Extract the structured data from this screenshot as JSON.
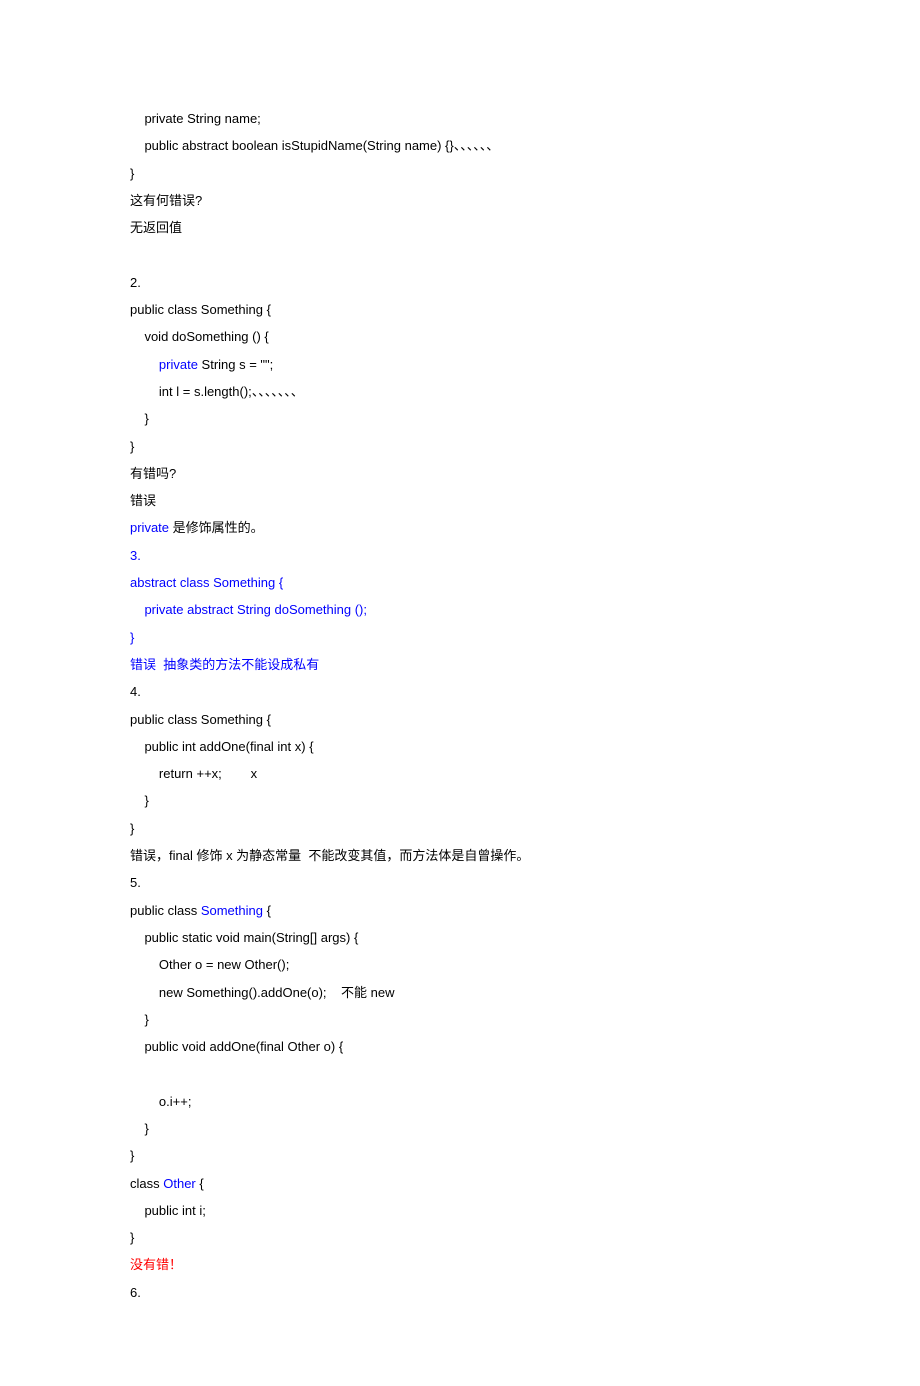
{
  "lines": [
    {
      "indent": 1,
      "segments": [
        {
          "text": "private String name;"
        }
      ]
    },
    {
      "indent": 1,
      "segments": [
        {
          "text": "public abstract boolean isStupidName(String name) {}、、、、、、"
        }
      ]
    },
    {
      "indent": 0,
      "segments": [
        {
          "text": "}"
        }
      ]
    },
    {
      "indent": 0,
      "segments": [
        {
          "text": "这有何错误?"
        }
      ]
    },
    {
      "indent": 0,
      "segments": [
        {
          "text": "无返回值"
        }
      ]
    },
    {
      "indent": 0,
      "segments": [
        {
          "text": " "
        }
      ]
    },
    {
      "indent": 0,
      "segments": [
        {
          "text": "2."
        }
      ]
    },
    {
      "indent": 0,
      "segments": [
        {
          "text": "public class Something {"
        }
      ]
    },
    {
      "indent": 1,
      "segments": [
        {
          "text": "void doSomething () {"
        }
      ]
    },
    {
      "indent": 2,
      "segments": [
        {
          "text": "private",
          "class": "blue"
        },
        {
          "text": " String s = \"\";"
        }
      ]
    },
    {
      "indent": 2,
      "segments": [
        {
          "text": "int l = s.length();、、、、、、、"
        }
      ]
    },
    {
      "indent": 1,
      "segments": [
        {
          "text": "}"
        }
      ]
    },
    {
      "indent": 0,
      "segments": [
        {
          "text": "}"
        }
      ]
    },
    {
      "indent": 0,
      "segments": [
        {
          "text": "有错吗?"
        }
      ]
    },
    {
      "indent": 0,
      "segments": [
        {
          "text": "错误"
        }
      ]
    },
    {
      "indent": 0,
      "segments": [
        {
          "text": "private ",
          "class": "blue"
        },
        {
          "text": "是修饰属性的。"
        }
      ]
    },
    {
      "indent": 0,
      "segments": [
        {
          "text": "3.",
          "class": "blue"
        }
      ]
    },
    {
      "indent": 0,
      "segments": [
        {
          "text": "abstract class Something {",
          "class": "blue"
        }
      ]
    },
    {
      "indent": 1,
      "segments": [
        {
          "text": "private abstract String doSomething ();",
          "class": "blue"
        }
      ]
    },
    {
      "indent": 0,
      "segments": [
        {
          "text": "}",
          "class": "blue"
        }
      ]
    },
    {
      "indent": 0,
      "segments": [
        {
          "text": "错误  抽象类的方法不能设成私有",
          "class": "blue"
        }
      ]
    },
    {
      "indent": 0,
      "segments": [
        {
          "text": "4."
        }
      ]
    },
    {
      "indent": 0,
      "segments": [
        {
          "text": "public class Something {"
        }
      ]
    },
    {
      "indent": 1,
      "segments": [
        {
          "text": "public int addOne(final int x) {"
        }
      ]
    },
    {
      "indent": 2,
      "segments": [
        {
          "text": "return ++x;        x"
        }
      ]
    },
    {
      "indent": 1,
      "segments": [
        {
          "text": "}"
        }
      ]
    },
    {
      "indent": 0,
      "segments": [
        {
          "text": "}"
        }
      ]
    },
    {
      "indent": 0,
      "segments": [
        {
          "text": "错误，final 修饰 x 为静态常量  不能改变其值，而方法体是自曾操作。"
        }
      ]
    },
    {
      "indent": 0,
      "segments": [
        {
          "text": "5."
        }
      ]
    },
    {
      "indent": 0,
      "segments": [
        {
          "text": "public class "
        },
        {
          "text": "Something",
          "class": "blue"
        },
        {
          "text": " {"
        }
      ]
    },
    {
      "indent": 1,
      "segments": [
        {
          "text": "public static void main(String[] args) {"
        }
      ]
    },
    {
      "indent": 2,
      "segments": [
        {
          "text": "Other o = new Other();"
        }
      ]
    },
    {
      "indent": 2,
      "segments": [
        {
          "text": "new Something().addOne(o);    不能 new"
        }
      ]
    },
    {
      "indent": 1,
      "segments": [
        {
          "text": "}"
        }
      ]
    },
    {
      "indent": 1,
      "segments": [
        {
          "text": "public void addOne(final Other o) {"
        }
      ]
    },
    {
      "indent": 0,
      "segments": [
        {
          "text": " "
        }
      ]
    },
    {
      "indent": 2,
      "segments": [
        {
          "text": "o.i++;"
        }
      ]
    },
    {
      "indent": 1,
      "segments": [
        {
          "text": "}"
        }
      ]
    },
    {
      "indent": 0,
      "segments": [
        {
          "text": "}"
        }
      ]
    },
    {
      "indent": 0,
      "segments": [
        {
          "text": "class "
        },
        {
          "text": "Other",
          "class": "blue"
        },
        {
          "text": " {"
        }
      ]
    },
    {
      "indent": 1,
      "segments": [
        {
          "text": "public int i;"
        }
      ]
    },
    {
      "indent": 0,
      "segments": [
        {
          "text": "}"
        }
      ]
    },
    {
      "indent": 0,
      "segments": [
        {
          "text": "没有错！",
          "class": "red"
        }
      ]
    },
    {
      "indent": 0,
      "segments": [
        {
          "text": "6."
        }
      ]
    }
  ]
}
